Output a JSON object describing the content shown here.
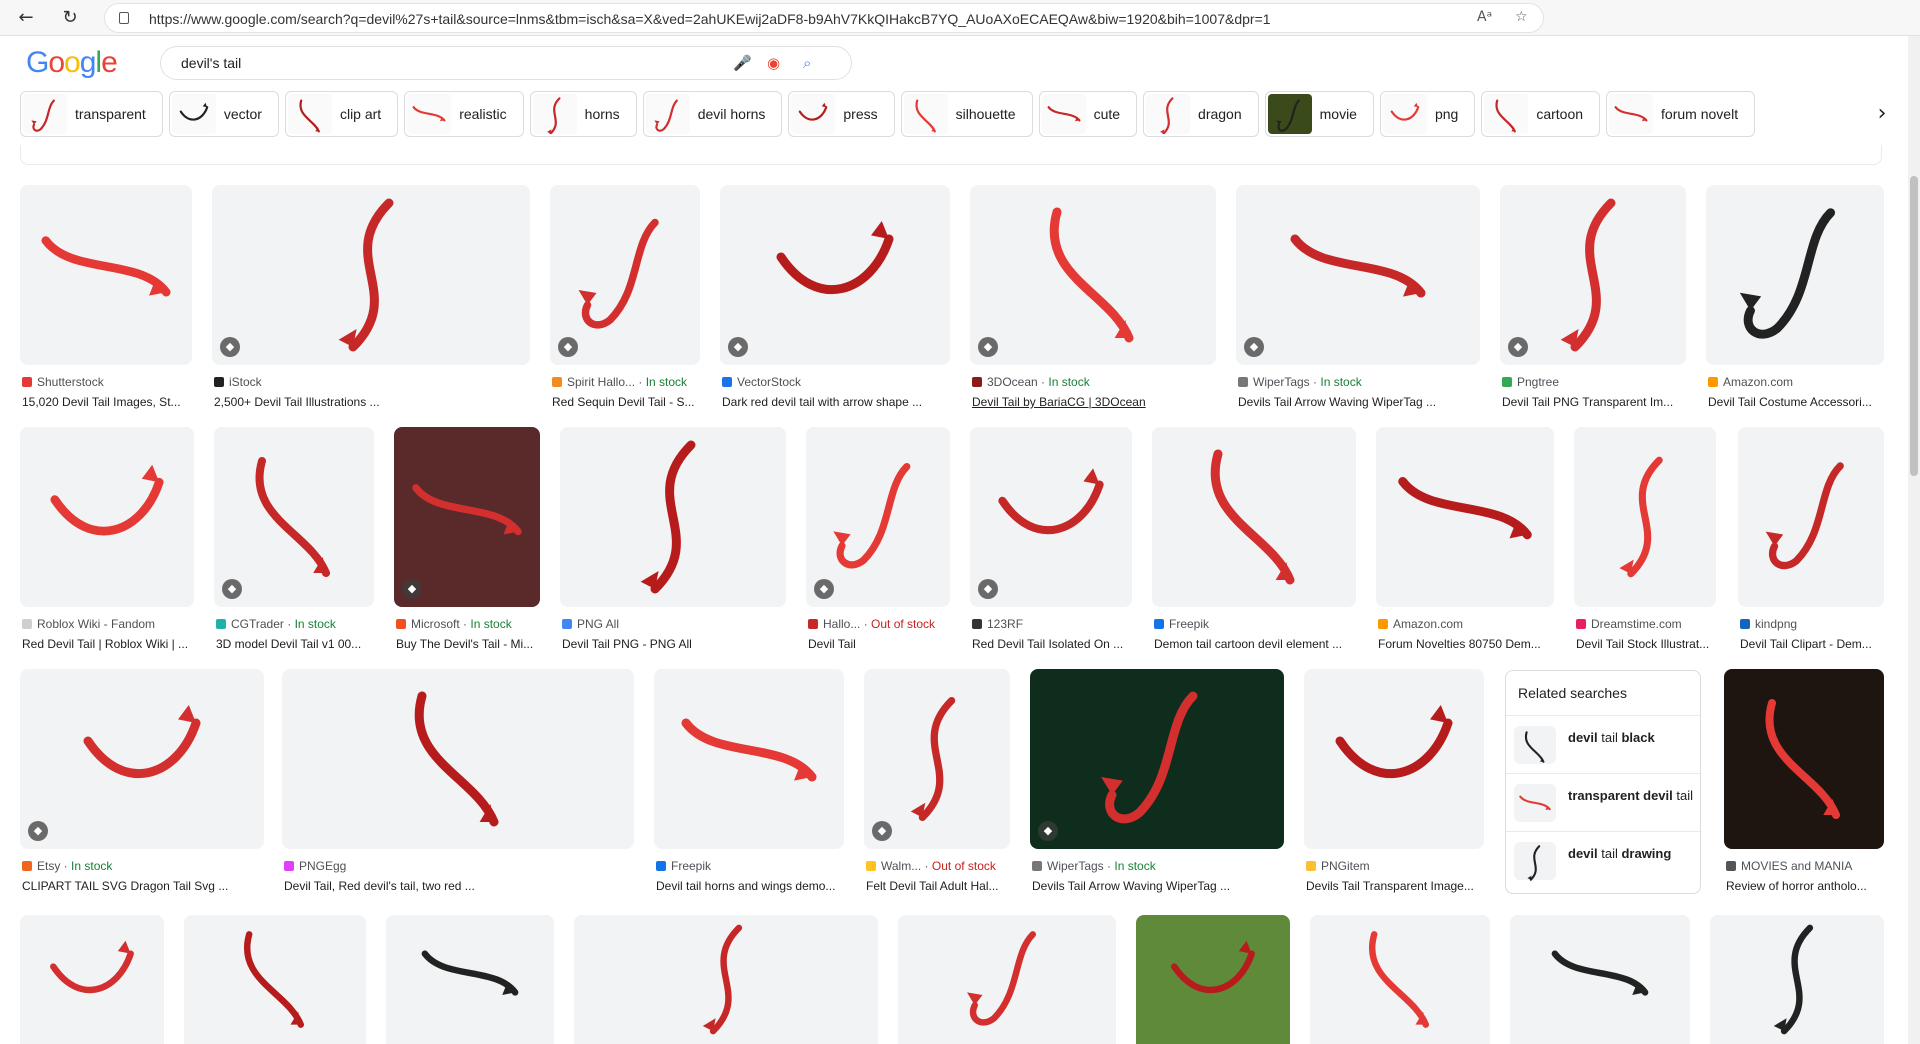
{
  "browser": {
    "url": "https://www.google.com/search?q=devil%27s+tail&source=lnms&tbm=isch&sa=X&ved=2ahUKEwij2aDF8-b9AhV7KkQIHakcB7YQ_AUoAXoECAEQAw&biw=1920&bih=1007&dpr=1"
  },
  "search": {
    "logo": "Google",
    "query": "devil's tail"
  },
  "chips": [
    "transparent",
    "vector",
    "clip art",
    "realistic",
    "horns",
    "devil horns",
    "press",
    "silhouette",
    "cute",
    "dragon",
    "movie",
    "png",
    "cartoon",
    "forum novelt"
  ],
  "results": [
    {
      "source": "Shutterstock",
      "stock": "",
      "title": "15,020 Devil Tail Images, St...",
      "fav": "#e53935"
    },
    {
      "source": "iStock",
      "stock": "",
      "title": "2,500+ Devil Tail Illustrations ...",
      "fav": "#222222"
    },
    {
      "source": "Spirit Hallo...",
      "stock": "In stock",
      "title": "Red Sequin Devil Tail - S...",
      "fav": "#f28b20"
    },
    {
      "source": "VectorStock",
      "stock": "",
      "title": "Dark red devil tail with arrow shape ...",
      "fav": "#1a73e8"
    },
    {
      "source": "3DOcean",
      "stock": "In stock",
      "title": "Devil Tail by BariaCG | 3DOcean",
      "fav": "#8b1a1a"
    },
    {
      "source": "WiperTags",
      "stock": "In stock",
      "title": "Devils Tail Arrow Waving WiperTag ...",
      "fav": "#777777"
    },
    {
      "source": "Pngtree",
      "stock": "",
      "title": "Devil Tail PNG Transparent Im...",
      "fav": "#34a853"
    },
    {
      "source": "Amazon.com",
      "stock": "",
      "title": "Devil Tail Costume Accessori...",
      "fav": "#ff9900"
    },
    {
      "source": "Roblox Wiki - Fandom",
      "stock": "",
      "title": "Red Devil Tail | Roblox Wiki | ...",
      "fav": "#cfcfcf"
    },
    {
      "source": "CGTrader",
      "stock": "In stock",
      "title": "3D model Devil Tail v1 00...",
      "fav": "#20b2aa"
    },
    {
      "source": "Microsoft",
      "stock": "In stock",
      "title": "Buy The Devil's Tail - Mi...",
      "fav": "#f25022"
    },
    {
      "source": "PNG All",
      "stock": "",
      "title": "Devil Tail PNG - PNG All",
      "fav": "#4285f4"
    },
    {
      "source": "Hallo...",
      "stock": "Out of stock",
      "title": "Devil Tail",
      "fav": "#c62828"
    },
    {
      "source": "123RF",
      "stock": "",
      "title": "Red Devil Tail Isolated On ...",
      "fav": "#333333"
    },
    {
      "source": "Freepik",
      "stock": "",
      "title": "Demon tail cartoon devil element ...",
      "fav": "#1273eb"
    },
    {
      "source": "Amazon.com",
      "stock": "",
      "title": "Forum Novelties 80750 Dem...",
      "fav": "#ff9900"
    },
    {
      "source": "Dreamstime.com",
      "stock": "",
      "title": "Devil Tail Stock Illustrat...",
      "fav": "#e91e63"
    },
    {
      "source": "kindpng",
      "stock": "",
      "title": "Devil Tail Clipart - Dem...",
      "fav": "#1565c0"
    },
    {
      "source": "Etsy",
      "stock": "In stock",
      "title": "CLIPART TAIL SVG Dragon Tail Svg ...",
      "fav": "#f1641e"
    },
    {
      "source": "PNGEgg",
      "stock": "",
      "title": "Devil Tail, Red devil's tail, two red ...",
      "fav": "#e040fb"
    },
    {
      "source": "Freepik",
      "stock": "",
      "title": "Devil tail horns and wings demo...",
      "fav": "#1273eb"
    },
    {
      "source": "Walm...",
      "stock": "Out of stock",
      "title": "Felt Devil Tail Adult Hal...",
      "fav": "#ffc220"
    },
    {
      "source": "WiperTags",
      "stock": "In stock",
      "title": "Devils Tail Arrow Waving WiperTag ...",
      "fav": "#777777"
    },
    {
      "source": "PNGitem",
      "stock": "",
      "title": "Devils Tail Transparent Image...",
      "fav": "#fbc02d"
    },
    {
      "source": "MOVIES and MANIA",
      "stock": "",
      "title": "Review of horror antholo...",
      "fav": "#555555"
    }
  ],
  "related": {
    "heading": "Related searches",
    "items": [
      {
        "bold1": "devil",
        "plain": " tail ",
        "bold2": "black"
      },
      {
        "bold1": "transparent devil",
        "plain": " tail",
        "bold2": ""
      },
      {
        "bold1": "devil",
        "plain": " tail ",
        "bold2": "drawing"
      }
    ]
  }
}
